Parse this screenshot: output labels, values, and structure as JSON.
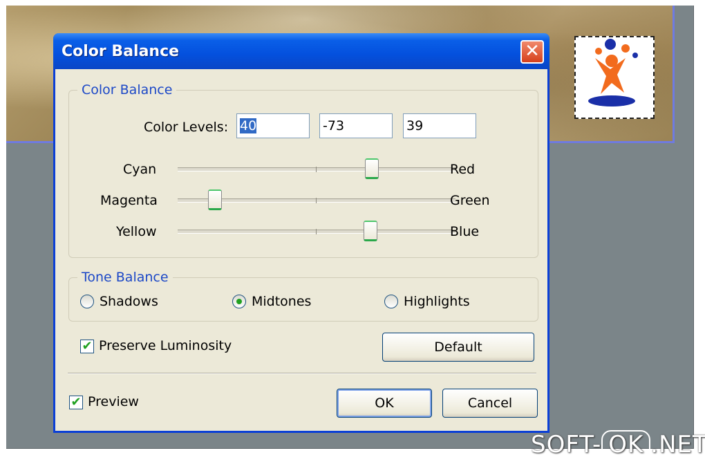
{
  "dialog": {
    "title": "Color Balance",
    "close_glyph": "✕"
  },
  "color_balance": {
    "group_title": "Color Balance",
    "levels_label": "Color Levels:",
    "levels": [
      "40",
      "-73",
      "39"
    ],
    "sliders": [
      {
        "left": "Cyan",
        "right": "Red",
        "value": 40
      },
      {
        "left": "Magenta",
        "right": "Green",
        "value": -73
      },
      {
        "left": "Yellow",
        "right": "Blue",
        "value": 39
      }
    ]
  },
  "tone_balance": {
    "group_title": "Tone Balance",
    "options": [
      "Shadows",
      "Midtones",
      "Highlights"
    ],
    "selected": "Midtones"
  },
  "preserve_luminosity": {
    "label": "Preserve Luminosity",
    "checked": true
  },
  "default_button": "Default",
  "preview": {
    "label": "Preview",
    "checked": true
  },
  "ok_button": "OK",
  "cancel_button": "Cancel",
  "watermark": {
    "part1": "SOFT-",
    "part2": "OK",
    "part3": ".NET"
  },
  "colors": {
    "title_bar": "#0450dd",
    "dialog_bg": "#ece9d8",
    "group_title": "#1c48c7",
    "slider_accent": "#2aa84a"
  }
}
